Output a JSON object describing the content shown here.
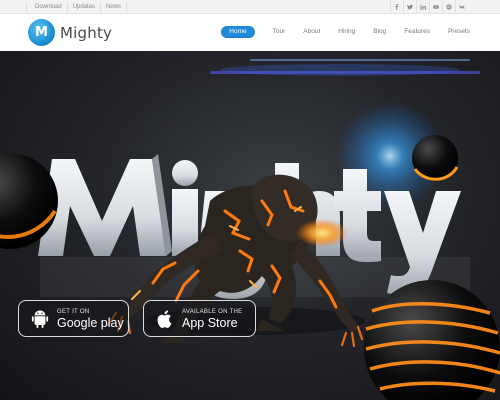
{
  "topbar": {
    "links": [
      "Download",
      "Updates",
      "News"
    ],
    "socials": [
      "facebook-icon",
      "twitter-icon",
      "linkedin-icon",
      "youtube-icon",
      "dribbble-icon",
      "vk-icon"
    ]
  },
  "header": {
    "logo_letter": "M",
    "logo_text": "Mighty",
    "nav": [
      "Home",
      "Tour",
      "About",
      "Hiring",
      "Blog",
      "Features",
      "Presets"
    ],
    "active_nav": "Home",
    "accent_color": "#1e8ad8"
  },
  "hero": {
    "headline": "Mighty",
    "google_button": {
      "small": "GET IT ON",
      "big": "Google play",
      "icon": "android-icon"
    },
    "apple_button": {
      "small": "AVAILABLE ON THE",
      "big": "App Store",
      "icon": "apple-icon"
    }
  }
}
